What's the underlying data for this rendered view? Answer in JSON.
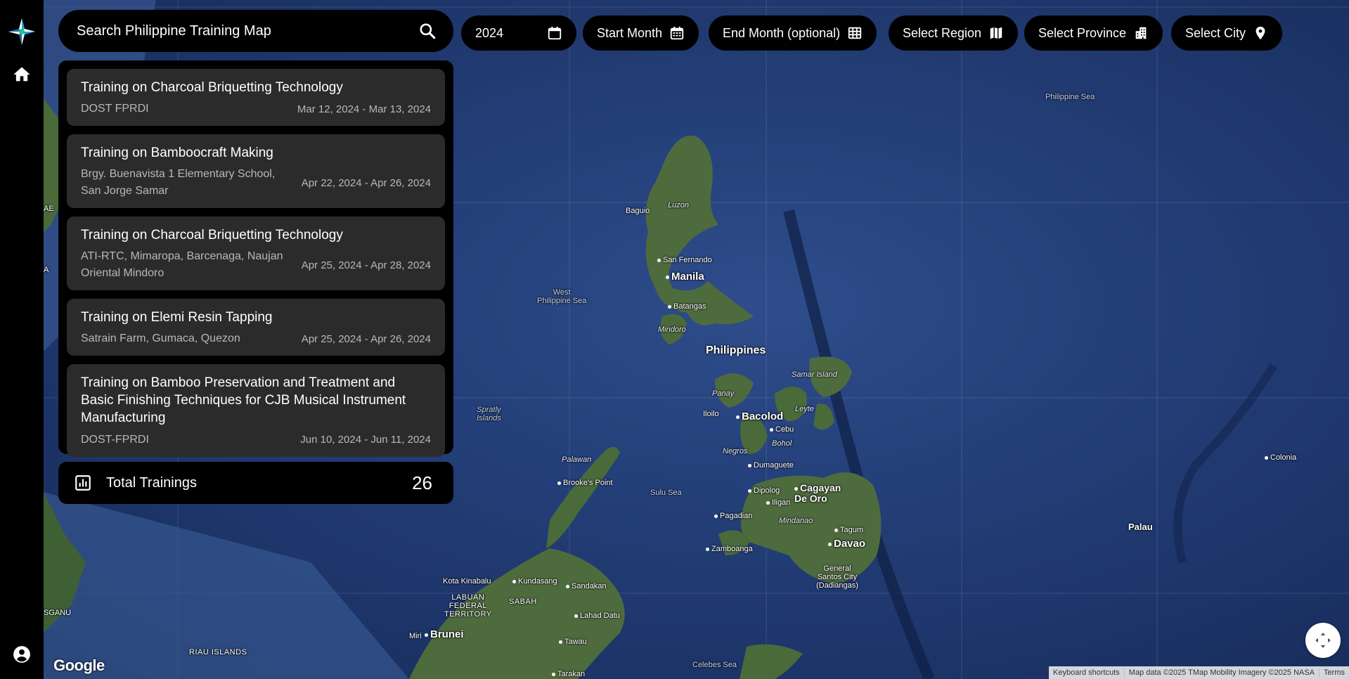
{
  "sidebar": {
    "logo_icon": "app-logo-icon",
    "home_icon": "home-icon",
    "account_icon": "account-circle-icon"
  },
  "search": {
    "placeholder": "Search Philippine Training Map",
    "icon": "search-icon"
  },
  "filters": {
    "year": {
      "value": "2024",
      "icon": "calendar-icon"
    },
    "start_month": {
      "label": "Start Month",
      "icon": "calendar-month-icon"
    },
    "end_month": {
      "label": "End Month (optional)",
      "icon": "calendar-grid-icon"
    },
    "region": {
      "label": "Select Region",
      "icon": "map-icon"
    },
    "province": {
      "label": "Select Province",
      "icon": "building-icon"
    },
    "city": {
      "label": "Select City",
      "icon": "location-pin-icon"
    }
  },
  "trainings": [
    {
      "title": "Training on Charcoal Briquetting Technology",
      "location": "DOST FPRDI",
      "dates": "Mar 12, 2024 - Mar 13, 2024"
    },
    {
      "title": "Training on Bamboocraft Making",
      "location": "Brgy. Buenavista 1 Elementary School, San Jorge Samar",
      "dates": "Apr 22, 2024 - Apr 26, 2024"
    },
    {
      "title": "Training on Charcoal Briquetting Technology",
      "location": "ATI-RTC, Mimaropa, Barcenaga, Naujan Oriental Mindoro",
      "dates": "Apr 25, 2024 - Apr 28, 2024"
    },
    {
      "title": "Training on Elemi Resin Tapping",
      "location": "Satrain Farm, Gumaca, Quezon",
      "dates": "Apr 25, 2024 - Apr 26, 2024"
    },
    {
      "title": "Training on Bamboo Preservation and Treatment and Basic Finishing Techniques for CJB Musical Instrument Manufacturing",
      "location": "DOST-FPRDI",
      "dates": "Jun 10, 2024 - Jun 11, 2024"
    }
  ],
  "total": {
    "label": "Total Trainings",
    "count": "26",
    "icon": "bar-chart-icon"
  },
  "map": {
    "labels": {
      "philippine_sea": "Philippine Sea",
      "luzon": "Luzon",
      "baguio": "Baguio",
      "san_fernando": "San Fernando",
      "manila": "Manila",
      "batangas": "Batangas",
      "mindoro": "Mindoro",
      "west_philippine_sea": "West\nPhilippine Sea",
      "philippines": "Philippines",
      "samar_island": "Samar Island",
      "panay": "Panay",
      "leyte": "Leyte",
      "iloilo": "Iloilo",
      "bacolod": "Bacolod",
      "cebu": "Cebu",
      "bohol": "Bohol",
      "negros": "Negros",
      "dumaguete": "Dumaguete",
      "spratly": "Spratly\nIslands",
      "palawan": "Palawan",
      "brookes_point": "Brooke's Point",
      "sulu_sea": "Sulu Sea",
      "dipolog": "Dipolog",
      "cagayan_de_oro": "Cagayan\nDe Oro",
      "iligan": "Iligan",
      "pagadian": "Pagadian",
      "mindanao": "Mindanao",
      "tagum": "Tagum",
      "davao": "Davao",
      "zamboanga": "Zamboanga",
      "general_santos": "General\nSantos City\n(Dadiangas)",
      "palau": "Palau",
      "colonia": "Colonia",
      "kota_kinabalu": "Kota Kinabalu",
      "kundasang": "Kundasang",
      "sandakan": "Sandakan",
      "labuan": "LABUAN\nFEDERAL\nTERRITORY",
      "sabah": "SABAH",
      "lahad_datu": "Lahad Datu",
      "miri": "Miri",
      "brunei": "Brunei",
      "tawau": "Tawau",
      "celebes_sea": "Celebes Sea",
      "tarakan": "Tarakan",
      "riau_islands": "RIAU ISLANDS",
      "sganu": "SGANU",
      "ae": "AE",
      "a": "A"
    },
    "google_logo": "Google",
    "attribution": {
      "shortcuts": "Keyboard shortcuts",
      "data": "Map data ©2025 TMap Mobility Imagery ©2025 NASA",
      "terms": "Terms"
    },
    "fullscreen_icon": "fullscreen-icon"
  }
}
